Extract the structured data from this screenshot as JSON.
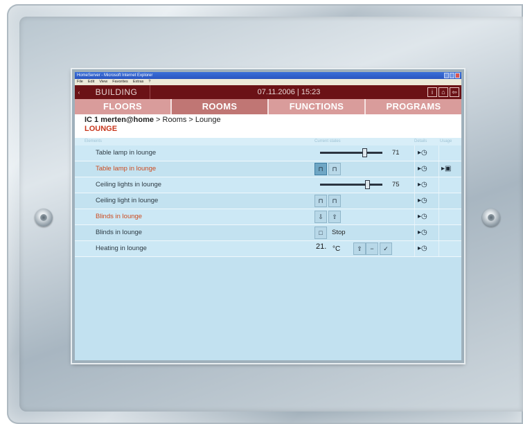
{
  "window": {
    "title": "HomeServer - Microsoft Internet Explorer",
    "menu": [
      "File",
      "Edit",
      "View",
      "Favorites",
      "Extras",
      "?"
    ]
  },
  "header": {
    "back_arrow": "‹",
    "building_label": "BUILDING",
    "datetime": "07.11.2006 | 15:23",
    "icons": [
      "info-icon",
      "home-icon",
      "exit-icon"
    ]
  },
  "tabs": [
    {
      "label": "FLOORS",
      "active": false
    },
    {
      "label": "ROOMS",
      "active": true
    },
    {
      "label": "FUNCTIONS",
      "active": false
    },
    {
      "label": "PROGRAMS",
      "active": false
    }
  ],
  "breadcrumb": {
    "site": "IC 1 merten@home",
    "path": " > Rooms > Lounge"
  },
  "room_title": "LOUNGE",
  "columns": {
    "elements": "Elements",
    "status": "Current states",
    "details": "Details",
    "usage": "Usage"
  },
  "rows": [
    {
      "label": "Table lamp in lounge",
      "alert": false,
      "control": "slider",
      "value": "71",
      "level": 0.71,
      "usage": false
    },
    {
      "label": "Table lamp in lounge",
      "alert": true,
      "control": "onoff",
      "pressed": "on",
      "usage": true
    },
    {
      "label": "Ceiling lights in lounge",
      "alert": false,
      "control": "slider",
      "value": "75",
      "level": 0.75,
      "usage": false
    },
    {
      "label": "Ceiling light in lounge",
      "alert": false,
      "control": "onoff",
      "pressed": "none",
      "usage": false
    },
    {
      "label": "Blinds in lounge",
      "alert": true,
      "control": "updown",
      "usage": false
    },
    {
      "label": "Blinds in lounge",
      "alert": false,
      "control": "stop",
      "stop_label": "Stop",
      "usage": false
    },
    {
      "label": "Heating in lounge",
      "alert": false,
      "control": "temp",
      "temp_value": "21.",
      "temp_unit": "°C",
      "usage": false
    }
  ],
  "icons": {
    "detail": "▸◷",
    "usage": "▸▣"
  }
}
